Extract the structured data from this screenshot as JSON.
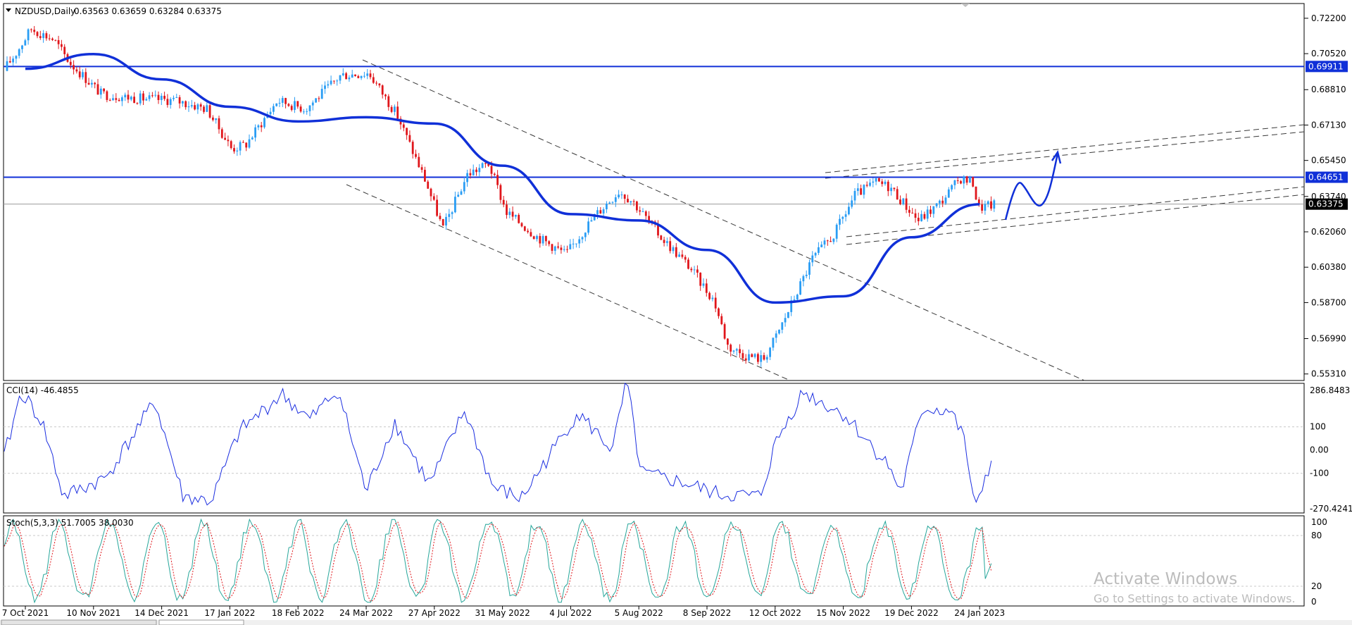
{
  "header": {
    "symbol": "NZDUSD,Daily",
    "ohlc": "0.63563 0.63659 0.63284 0.63375"
  },
  "price_axis": {
    "ticks": [
      "0.72200",
      "0.70520",
      "0.68810",
      "0.67130",
      "0.65450",
      "0.63740",
      "0.62060",
      "0.60380",
      "0.58700",
      "0.56990",
      "0.55310"
    ],
    "labels": {
      "upper_line": "0.69911",
      "middle_line": "0.64651",
      "current": "0.63375"
    }
  },
  "cci": {
    "label": "CCI(14) -46.4855",
    "ticks": [
      "286.8483",
      "100",
      "0.00",
      "-100",
      "-270.4241"
    ]
  },
  "stoch": {
    "label": "Stoch(5,3,3) 51.7005 38.0030",
    "ticks": [
      "100",
      "80",
      "20",
      "0"
    ]
  },
  "time_axis": {
    "labels": [
      "7 Oct 2021",
      "10 Nov 2021",
      "14 Dec 2021",
      "17 Jan 2022",
      "18 Feb 2022",
      "24 Mar 2022",
      "27 Apr 2022",
      "31 May 2022",
      "4 Jul 2022",
      "5 Aug 2022",
      "8 Sep 2022",
      "12 Oct 2022",
      "15 Nov 2022",
      "19 Dec 2022",
      "24 Jan 2023"
    ]
  },
  "watermark": {
    "line1": "Activate Windows",
    "line2": "Go to Settings to activate Windows."
  },
  "colors": {
    "bull": "#2a9df4",
    "bear": "#e0161b",
    "line": "#1030d8",
    "cci": "#1b2ee0",
    "stoch_main": "#26a69a",
    "stoch_signal": "#e0161b",
    "grid": "#c8c8c8"
  },
  "chart_data": [
    {
      "type": "candlestick",
      "series": [
        {
          "name": "NZDUSD,Daily",
          "open": 0.63563,
          "high": 0.63659,
          "low": 0.63284,
          "close": 0.63375
        }
      ],
      "ylim": [
        0.55,
        0.729
      ],
      "horizontal_lines": [
        0.69911,
        0.64651
      ],
      "x_categories": [
        "7 Oct 2021",
        "10 Nov 2021",
        "14 Dec 2021",
        "17 Jan 2022",
        "18 Feb 2022",
        "24 Mar 2022",
        "27 Apr 2022",
        "31 May 2022",
        "4 Jul 2022",
        "5 Aug 2022",
        "8 Sep 2022",
        "12 Oct 2022",
        "15 Nov 2022",
        "19 Dec 2022",
        "24 Jan 2023"
      ],
      "moving_average": [
        [
          "7 Oct 2021",
          0.698
        ],
        [
          "10 Nov 2021",
          0.705
        ],
        [
          "14 Dec 2021",
          0.693
        ],
        [
          "17 Jan 2022",
          0.68
        ],
        [
          "18 Feb 2022",
          0.673
        ],
        [
          "24 Mar 2022",
          0.675
        ],
        [
          "27 Apr 2022",
          0.672
        ],
        [
          "31 May 2022",
          0.652
        ],
        [
          "4 Jul 2022",
          0.629
        ],
        [
          "5 Aug 2022",
          0.626
        ],
        [
          "8 Sep 2022",
          0.612
        ],
        [
          "12 Oct 2022",
          0.587
        ],
        [
          "15 Nov 2022",
          0.59
        ],
        [
          "19 Dec 2022",
          0.618
        ],
        [
          "24 Jan 2023",
          0.6337
        ]
      ]
    },
    {
      "type": "line",
      "name": "CCI(14)",
      "last_value": -46.4855,
      "ylim": [
        -270.4241,
        286.8483
      ]
    },
    {
      "type": "line",
      "name": "Stoch(5,3,3)",
      "main": 51.7005,
      "signal": 38.003,
      "ylim": [
        0,
        100
      ]
    }
  ]
}
